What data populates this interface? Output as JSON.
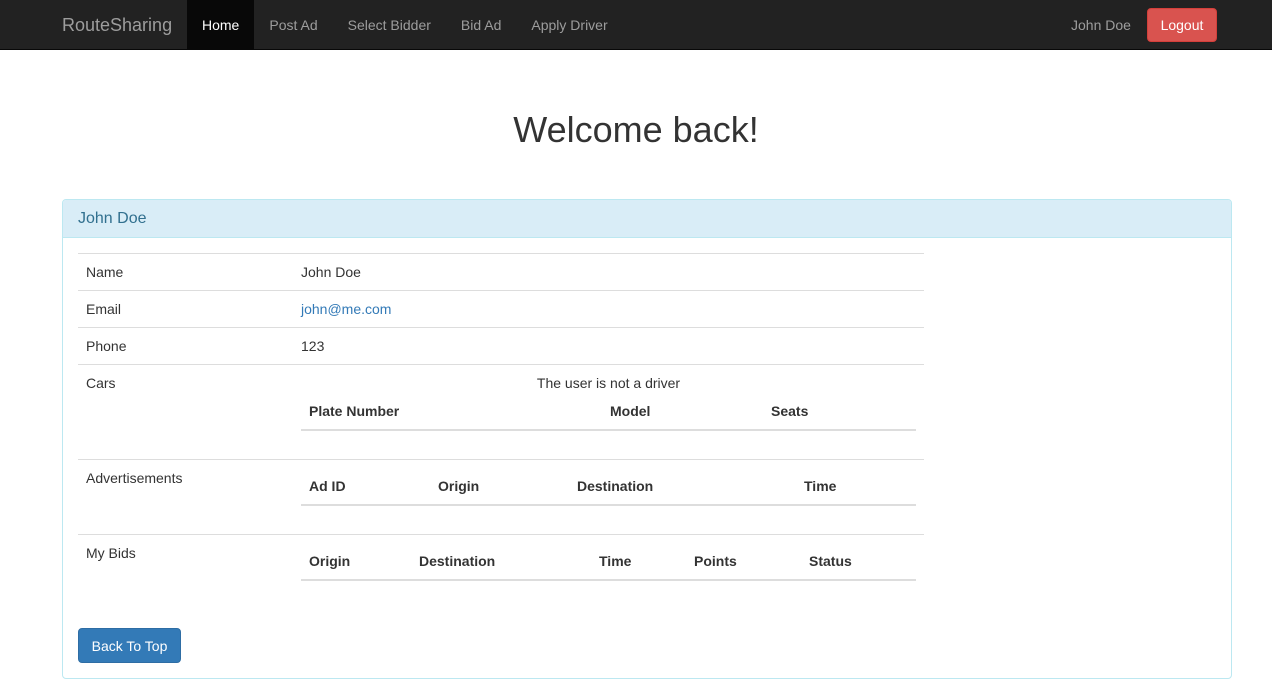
{
  "nav": {
    "brand": "RouteSharing",
    "links": [
      "Home",
      "Post Ad",
      "Select Bidder",
      "Bid Ad",
      "Apply Driver"
    ],
    "user": "John Doe",
    "logout": "Logout"
  },
  "welcome": "Welcome back!",
  "panel": {
    "title": "John Doe",
    "rows": {
      "name": {
        "label": "Name",
        "value": "John Doe"
      },
      "email": {
        "label": "Email",
        "value": "john@me.com"
      },
      "phone": {
        "label": "Phone",
        "value": "123"
      },
      "cars": {
        "label": "Cars",
        "note": "The user is not a driver",
        "headers": [
          "Plate Number",
          "Model",
          "Seats"
        ]
      },
      "ads": {
        "label": "Advertisements",
        "headers": [
          "Ad ID",
          "Origin",
          "Destination",
          "Time"
        ]
      },
      "bids": {
        "label": "My Bids",
        "headers": [
          "Origin",
          "Destination",
          "Time",
          "Points",
          "Status"
        ]
      }
    },
    "back_to_top": "Back To Top"
  },
  "colors": {
    "navbar": "#222222",
    "active_nav": "#080808",
    "logout": "#d9534f",
    "primary": "#337ab7",
    "panel_heading_bg": "#d9edf7",
    "panel_heading_text": "#31708f"
  }
}
